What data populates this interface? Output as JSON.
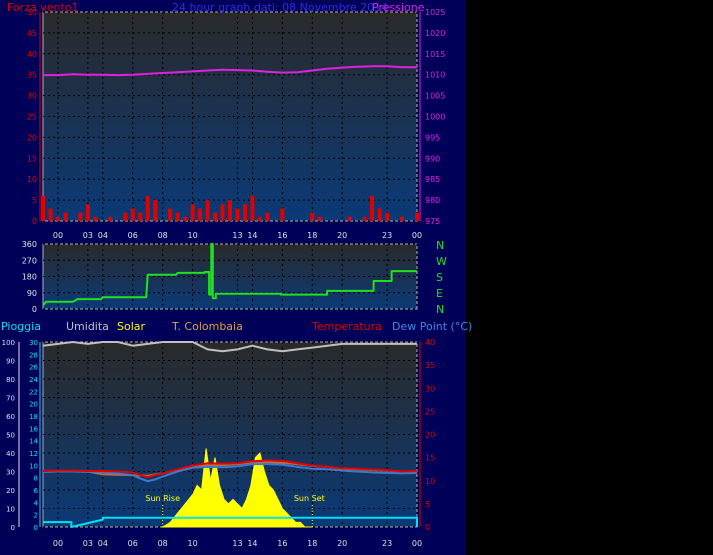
{
  "header": {
    "wind_label": "Forza vento1",
    "title": "24 hour graph dati: 08 Novembre 2014",
    "pressure_label": "Pressione"
  },
  "legend_bottom": {
    "rain": "Pioggia",
    "humidity": "Umidita",
    "solar": "Solar",
    "colombaia": "T. Colombaia",
    "temperature": "Temperatura",
    "dewpoint": "Dew Point (°C)"
  },
  "annotations": {
    "sunrise": "Sun Rise",
    "sunset": "Sun Set"
  },
  "compass": [
    "N",
    "W",
    "S",
    "E",
    "N"
  ],
  "colors": {
    "panel_top": "#2a2a2a",
    "panel_bottom": "#0a3a78",
    "pressure": "#e020e0",
    "wind": "#e00000",
    "direction": "#20e020",
    "humidity": "#c0c0c0",
    "solar": "#ffff00",
    "temperature": "#e00000",
    "dewpoint": "#3a7ad0",
    "colombaia": "#c07040",
    "rain": "#00e0f0"
  },
  "chart_data": [
    {
      "type": "line",
      "name": "wind-pressure",
      "x_ticks": [
        "00",
        "03",
        "04",
        "06",
        "08",
        "10",
        "13",
        "14",
        "16",
        "18",
        "20",
        "23",
        "00"
      ],
      "y_left_ticks": [
        0,
        5,
        10,
        15,
        20,
        25,
        30,
        35,
        40,
        45,
        50
      ],
      "y_right_ticks": [
        975,
        980,
        985,
        990,
        995,
        1000,
        1005,
        1010,
        1015,
        1020,
        1025
      ],
      "ylim_left": [
        0,
        50
      ],
      "ylim_right": [
        975,
        1025
      ],
      "series": [
        {
          "name": "Pressione",
          "x_hours": [
            -1,
            0,
            1,
            2,
            3,
            4,
            5,
            6,
            7,
            8,
            9,
            10,
            11,
            12,
            13,
            14,
            15,
            16,
            17,
            18,
            19,
            20,
            21,
            22,
            23,
            24
          ],
          "values": [
            1009.9,
            1009.9,
            1010.1,
            1010.0,
            1010.0,
            1009.9,
            1010.0,
            1010.2,
            1010.4,
            1010.6,
            1010.8,
            1011.0,
            1011.2,
            1011.1,
            1011.0,
            1010.7,
            1010.5,
            1010.6,
            1011.0,
            1011.4,
            1011.7,
            1011.9,
            1012.0,
            1012.0,
            1011.8,
            1011.8
          ]
        },
        {
          "name": "Forza vento1",
          "x_hours": [
            -1,
            -0.5,
            0,
            0.5,
            1,
            1.5,
            2,
            2.5,
            3,
            3.5,
            4,
            4.5,
            5,
            5.5,
            6,
            6.5,
            7,
            7.5,
            8,
            8.5,
            9,
            9.5,
            10,
            10.5,
            11,
            11.5,
            12,
            12.5,
            13,
            13.5,
            14,
            14.5,
            15,
            15.5,
            16,
            16.5,
            17,
            17.5,
            18,
            18.5,
            19,
            19.5,
            20,
            20.5,
            21,
            21.5,
            22,
            22.5,
            23,
            23.5,
            24
          ],
          "values": [
            6,
            3,
            1,
            2,
            0,
            2,
            4,
            1,
            0,
            1,
            0,
            2,
            3,
            2,
            6,
            5,
            0,
            3,
            2,
            1,
            4,
            3,
            5,
            2,
            4,
            5,
            3,
            4,
            6,
            1,
            2,
            0,
            3,
            0,
            0,
            0,
            2,
            1,
            0,
            0,
            0,
            1,
            0,
            1,
            6,
            3,
            2,
            0,
            1,
            0,
            2
          ]
        }
      ]
    },
    {
      "type": "line",
      "name": "wind-direction",
      "y_ticks": [
        0,
        90,
        180,
        270,
        360
      ],
      "ylim": [
        0,
        360
      ],
      "series": [
        {
          "name": "direction",
          "x_hours": [
            -1,
            -0.8,
            1,
            1.3,
            2.9,
            3.0,
            5.9,
            6.0,
            7.9,
            8.0,
            9.8,
            9.8,
            10.1,
            10.1,
            10.25,
            10.25,
            10.35,
            10.35,
            10.55,
            10.55,
            14.9,
            14.9,
            18.0,
            18.0,
            21.1,
            21.1,
            22.3,
            22.3,
            24
          ],
          "values": [
            20,
            40,
            40,
            55,
            55,
            65,
            65,
            190,
            190,
            200,
            200,
            205,
            205,
            80,
            80,
            360,
            360,
            60,
            60,
            85,
            85,
            80,
            80,
            100,
            100,
            155,
            155,
            210,
            210
          ]
        }
      ]
    },
    {
      "type": "line",
      "name": "temperature-humidity-rain",
      "y_rain_ticks": [
        0,
        2,
        4,
        6,
        8,
        10,
        12,
        14,
        16,
        18,
        20,
        22,
        24,
        26,
        28,
        30
      ],
      "y_humidity_ticks": [
        0,
        10,
        20,
        30,
        40,
        50,
        60,
        70,
        80,
        90,
        100
      ],
      "y_temp_ticks": [
        0,
        5,
        10,
        15,
        20,
        25,
        30,
        35,
        40
      ],
      "ylim_temp": [
        0,
        40
      ],
      "ylim_humidity": [
        0,
        100
      ],
      "ylim_rain": [
        0,
        30
      ],
      "series": [
        {
          "name": "Umidita",
          "x_hours": [
            -1,
            0,
            1,
            2,
            3,
            4,
            5,
            6,
            7,
            8,
            9,
            10,
            11,
            12,
            13,
            14,
            15,
            16,
            17,
            18,
            19,
            20,
            21,
            22,
            23,
            24
          ],
          "values": [
            98,
            99,
            100,
            99,
            100,
            100,
            98,
            99,
            100,
            100,
            100,
            96,
            95,
            96,
            98,
            96,
            95,
            96,
            97,
            98,
            99,
            99,
            99,
            99,
            99,
            99
          ]
        },
        {
          "name": "Temperatura",
          "x_hours": [
            -1,
            0,
            1,
            2,
            3,
            4,
            5,
            5.5,
            6,
            6.5,
            7,
            8,
            9,
            10,
            11,
            12,
            13,
            14,
            15,
            16,
            17,
            18,
            19,
            20,
            21,
            22,
            23,
            24
          ],
          "values": [
            12.1,
            12.2,
            12.2,
            12.1,
            12.1,
            12.0,
            11.8,
            11.2,
            10.8,
            11.2,
            11.6,
            12.5,
            13.3,
            13.8,
            13.7,
            13.8,
            14.2,
            14.4,
            14.3,
            13.8,
            13.3,
            13.0,
            12.7,
            12.6,
            12.4,
            12.3,
            12.0,
            12.1
          ]
        },
        {
          "name": "Dew Point",
          "x_hours": [
            -1,
            0,
            1,
            2,
            3,
            4,
            5,
            5.5,
            6,
            6.5,
            7,
            8,
            9,
            10,
            11,
            12,
            13,
            14,
            15,
            16,
            17,
            18,
            19,
            20,
            21,
            22,
            23,
            24
          ],
          "values": [
            11.9,
            12.0,
            12.0,
            11.9,
            11.9,
            11.6,
            11.2,
            10.5,
            9.9,
            10.3,
            10.9,
            12.0,
            12.8,
            13.0,
            12.9,
            13.1,
            13.6,
            13.6,
            13.5,
            13.0,
            12.6,
            12.5,
            12.2,
            12.0,
            11.8,
            11.7,
            11.6,
            11.7
          ]
        },
        {
          "name": "T. Colombaia",
          "x_hours": [
            -1,
            0,
            1,
            2,
            3,
            4,
            5,
            6,
            7,
            8,
            9,
            10,
            11,
            12,
            13,
            14,
            15,
            16,
            17,
            18,
            19,
            20,
            21,
            22,
            23,
            24
          ],
          "values": [
            12.0,
            12.1,
            12.1,
            12.0,
            11.4,
            11.3,
            11.2,
            11.1,
            11.6,
            12.4,
            13.2,
            13.3,
            13.4,
            13.6,
            14.0,
            14.0,
            13.9,
            13.6,
            13.2,
            13.0,
            12.6,
            12.5,
            12.3,
            12.2,
            12.0,
            12.0
          ]
        },
        {
          "name": "Solar",
          "x_hours": [
            7.0,
            7.5,
            8.0,
            8.5,
            9.0,
            9.3,
            9.6,
            9.9,
            10.2,
            10.5,
            10.8,
            11.1,
            11.4,
            11.7,
            12.0,
            12.3,
            12.6,
            12.9,
            13.2,
            13.5,
            13.8,
            14.1,
            14.4,
            14.7,
            15.0,
            15.3,
            15.6,
            15.9,
            16.2,
            16.5,
            17.0
          ],
          "values": [
            0,
            1,
            3,
            5,
            7,
            9,
            8,
            17,
            10,
            15,
            9,
            6,
            5,
            6,
            5,
            4,
            6,
            9,
            15,
            16,
            12,
            9,
            8,
            6,
            4,
            3,
            2,
            1,
            1,
            0,
            0
          ]
        },
        {
          "name": "Pioggia",
          "x_hours": [
            -1,
            0.9,
            0.9,
            3,
            3,
            24,
            24
          ],
          "values": [
            0.8,
            0.8,
            0,
            1.2,
            1.5,
            1.5,
            0
          ]
        }
      ]
    }
  ]
}
